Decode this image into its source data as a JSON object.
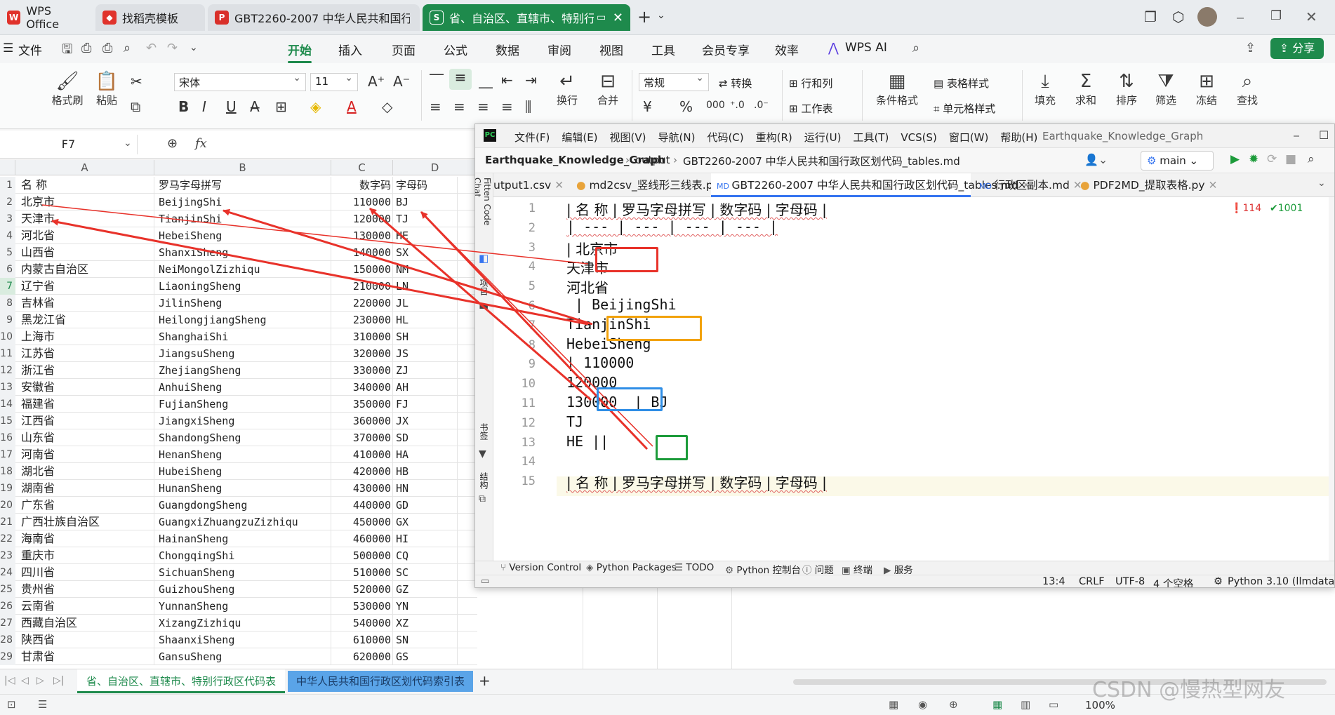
{
  "tabs": [
    {
      "label": "WPS Office"
    },
    {
      "label": "找稻壳模板"
    },
    {
      "label": "GBT2260-2007 中华人民共和国行政"
    },
    {
      "label": "省、自治区、直辖市、特别行"
    }
  ],
  "menu": {
    "file": "文件",
    "items": [
      "开始",
      "插入",
      "页面",
      "公式",
      "数据",
      "审阅",
      "视图",
      "工具",
      "会员专享",
      "效率"
    ],
    "wps_ai": "WPS AI",
    "share": "分享"
  },
  "ribbon": {
    "format_painter": "格式刷",
    "paste": "粘贴",
    "font": "宋体",
    "size": "11",
    "wrap": "换行",
    "merge": "合并",
    "number_format": "常规",
    "convert": "转换",
    "row_col": "行和列",
    "worksheet": "工作表",
    "cond_format": "条件格式",
    "table_style": "表格样式",
    "cell_style": "单元格样式",
    "fill": "填充",
    "sum": "求和",
    "sort": "排序",
    "filter": "筛选",
    "freeze": "冻结",
    "find": "查找"
  },
  "formula_bar": {
    "cell_ref": "F7",
    "fx": "fx"
  },
  "sheet": {
    "columns": [
      "A",
      "B",
      "C",
      "D"
    ],
    "rows": [
      [
        "1",
        "名 称",
        "罗马字母拼写",
        "数字码",
        "字母码"
      ],
      [
        "2",
        "北京市",
        "BeijingShi",
        "110000",
        "BJ"
      ],
      [
        "3",
        "天津市",
        "TianjinShi",
        "120000",
        "TJ"
      ],
      [
        "4",
        "河北省",
        "HebeiSheng",
        "130000",
        "HE"
      ],
      [
        "5",
        "山西省",
        "ShanxiSheng",
        "140000",
        "SX"
      ],
      [
        "6",
        "内蒙古自治区",
        "NeiMongolZizhiqu",
        "150000",
        "NM"
      ],
      [
        "7",
        "辽宁省",
        "LiaoningSheng",
        "210000",
        "LN"
      ],
      [
        "8",
        "吉林省",
        "JilinSheng",
        "220000",
        "JL"
      ],
      [
        "9",
        "黑龙江省",
        "HeilongjiangSheng",
        "230000",
        "HL"
      ],
      [
        "10",
        "上海市",
        "ShanghaiShi",
        "310000",
        "SH"
      ],
      [
        "11",
        "江苏省",
        "JiangsuSheng",
        "320000",
        "JS"
      ],
      [
        "12",
        "浙江省",
        "ZhejiangSheng",
        "330000",
        "ZJ"
      ],
      [
        "13",
        "安徽省",
        "AnhuiSheng",
        "340000",
        "AH"
      ],
      [
        "14",
        "福建省",
        "FujianSheng",
        "350000",
        "FJ"
      ],
      [
        "15",
        "江西省",
        "JiangxiSheng",
        "360000",
        "JX"
      ],
      [
        "16",
        "山东省",
        "ShandongSheng",
        "370000",
        "SD"
      ],
      [
        "17",
        "河南省",
        "HenanSheng",
        "410000",
        "HA"
      ],
      [
        "18",
        "湖北省",
        "HubeiSheng",
        "420000",
        "HB"
      ],
      [
        "19",
        "湖南省",
        "HunanSheng",
        "430000",
        "HN"
      ],
      [
        "20",
        "广东省",
        "GuangdongSheng",
        "440000",
        "GD"
      ],
      [
        "21",
        "广西壮族自治区",
        "GuangxiZhuangzuZizhiqu",
        "450000",
        "GX"
      ],
      [
        "22",
        "海南省",
        "HainanSheng",
        "460000",
        "HI"
      ],
      [
        "23",
        "重庆市",
        "ChongqingShi",
        "500000",
        "CQ"
      ],
      [
        "24",
        "四川省",
        "SichuanSheng",
        "510000",
        "SC"
      ],
      [
        "25",
        "贵州省",
        "GuizhouSheng",
        "520000",
        "GZ"
      ],
      [
        "26",
        "云南省",
        "YunnanSheng",
        "530000",
        "YN"
      ],
      [
        "27",
        "西藏自治区",
        "XizangZizhiqu",
        "540000",
        "XZ"
      ],
      [
        "28",
        "陕西省",
        "ShaanxiSheng",
        "610000",
        "SN"
      ],
      [
        "29",
        "甘肃省",
        "GansuSheng",
        "620000",
        "GS"
      ]
    ],
    "tab_active": "省、自治区、直辖市、特别行政区代码表",
    "tab_other": "中华人民共和国行政区划代码索引表",
    "zoom": "100%"
  },
  "ide": {
    "menu": [
      "文件(F)",
      "编辑(E)",
      "视图(V)",
      "导航(N)",
      "代码(C)",
      "重构(R)",
      "运行(U)",
      "工具(T)",
      "VCS(S)",
      "窗口(W)",
      "帮助(H)"
    ],
    "project_title": "Earthquake_Knowledge_Graph",
    "breadcrumb": [
      "Earthquake_Knowledge_Graph",
      "output",
      "GBT2260-2007 中华人民共和国行政区划代码_tables.md"
    ],
    "branch": "main",
    "tabs": [
      "utput1.csv",
      "md2csv_竖线形三线表.py",
      "GBT2260-2007 中华人民共和国行政区划代码_tables.md",
      "行政区副本.md",
      "PDF2MD_提取表格.py"
    ],
    "side_labels": [
      "Fitten Code Chat",
      "项目",
      "书签",
      "结构"
    ],
    "line_numbers": [
      "1",
      "2",
      "3",
      "4",
      "5",
      "6",
      "7",
      "8",
      "9",
      "10",
      "11",
      "12",
      "13",
      "14",
      "15"
    ],
    "lines": [
      "| 名 称 | 罗马字母拼写 | 数字码 | 字母码 |",
      "| --- | --- | --- | --- |",
      "| 北京市",
      "天津市",
      "河北省",
      " | BeijingShi",
      "TianjinShi",
      "HebeiSheng",
      "| 110000",
      "120000",
      "130000  | BJ",
      "TJ",
      "HE ||",
      "",
      "| 名 称 | 罗马字母拼写 | 数字码 | 字母码 |"
    ],
    "inspections": {
      "errors": "114",
      "ok": "1001"
    },
    "tool_windows": [
      "Version Control",
      "Python Packages",
      "TODO",
      "Python 控制台",
      "问题",
      "终端",
      "服务"
    ],
    "status": [
      "13:4",
      "CRLF",
      "UTF-8",
      "4 个空格",
      "Python 3.10 (llmdata"
    ]
  },
  "watermark": "CSDN @慢热型网友",
  "colors": {
    "wps_green": "#1e8a4c",
    "arrow_red": "#e8322a",
    "box_red": "#e8322a",
    "box_orange": "#f2a20c",
    "box_blue": "#2f8ee6",
    "box_green": "#1c9b3a"
  }
}
